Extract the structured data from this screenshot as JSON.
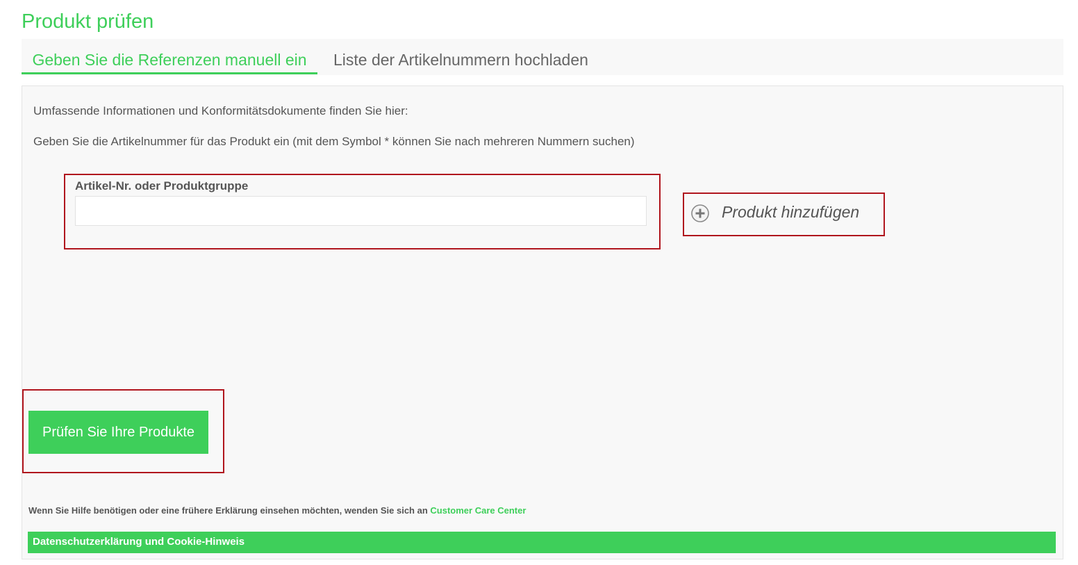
{
  "page": {
    "title": "Produkt prüfen"
  },
  "tabs": [
    {
      "label": "Geben Sie die Referenzen manuell ein",
      "active": true
    },
    {
      "label": "Liste der Artikelnummern hochladen",
      "active": false
    }
  ],
  "panel": {
    "info_1": "Umfassende Informationen und Konformitätsdokumente finden Sie hier:",
    "info_2": "Geben Sie die Artikelnummer für das Produkt ein (mit dem Symbol * können Sie nach mehreren Nummern suchen)",
    "field_label": "Artikel-Nr. oder Produktgruppe",
    "field_value": "",
    "add_product_label": "Produkt hinzufügen",
    "add_product_icon": "plus-circle-icon",
    "submit_label": "Prüfen Sie Ihre Produkte"
  },
  "help": {
    "text": "Wenn Sie Hilfe benötigen oder eine frühere Erklärung einsehen möchten, wenden Sie sich an",
    "link_label": "Customer Care Center"
  },
  "footer": {
    "link_label": "Datenschutzerklärung und Cookie-Hinweis"
  },
  "colors": {
    "accent": "#3ecf5a",
    "highlight_border": "#b0151d",
    "panel_background": "#f8f8f8"
  }
}
